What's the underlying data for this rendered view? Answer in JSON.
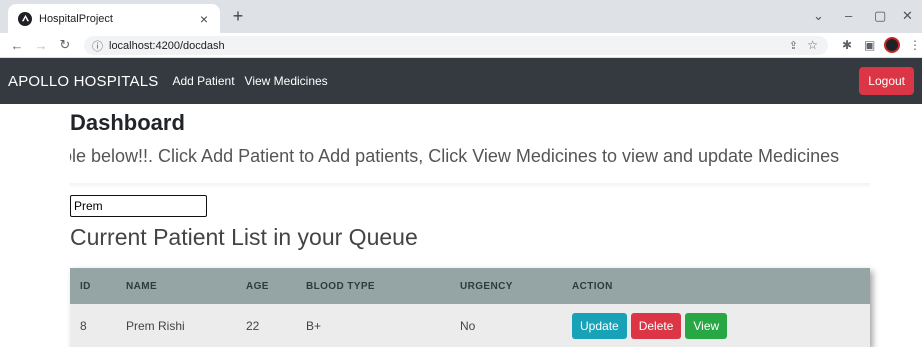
{
  "browser": {
    "tab_title": "HospitalProject",
    "tab_close": "×",
    "new_tab": "+",
    "url": "localhost:4200/docdash"
  },
  "navbar": {
    "brand": "APOLLO HOSPITALS",
    "links": [
      "Add Patient",
      "View Medicines"
    ],
    "logout_label": "Logout"
  },
  "main": {
    "title": "Dashboard",
    "subtitle": "ole below!!. Click Add Patient to Add patients, Click View Medicines to view and update Medicines",
    "search_value": "Prem",
    "list_title": "Current Patient List in your Queue"
  },
  "table": {
    "headers": [
      "ID",
      "NAME",
      "AGE",
      "BLOOD TYPE",
      "URGENCY",
      "ACTION"
    ],
    "rows": [
      {
        "id": "8",
        "name": "Prem Rishi",
        "age": "22",
        "blood_type": "B+",
        "urgency": "No"
      }
    ],
    "actions": {
      "update": "Update",
      "delete": "Delete",
      "view": "View"
    }
  },
  "colors": {
    "navbar": "#343a40",
    "logout": "#dc3545",
    "table_header": "#95a5a6",
    "update": "#17a2b8",
    "delete": "#dc3545",
    "view": "#28a745"
  }
}
